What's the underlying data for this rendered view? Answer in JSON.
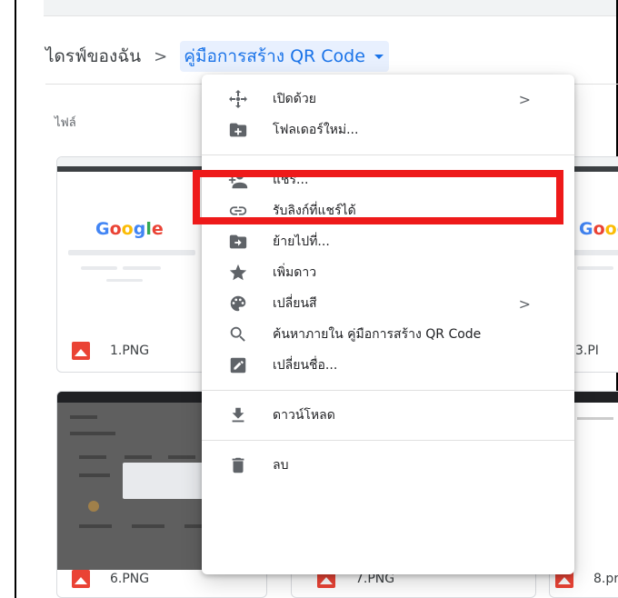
{
  "breadcrumb": {
    "root": "ไดรฟ์ของฉัน",
    "separator": ">",
    "current": "คู่มือการสร้าง QR Code"
  },
  "section": {
    "label": "ไฟล์"
  },
  "files": [
    {
      "name": "1.PNG",
      "thumb_text": "Google"
    },
    {
      "name": "3.PI",
      "thumb_text": "Goo"
    },
    {
      "name": "6.PNG"
    },
    {
      "name": "7.PNG"
    },
    {
      "name": "8.pr"
    }
  ],
  "menu": {
    "items": [
      {
        "icon": "open-with-icon",
        "label": "เปิดด้วย",
        "has_submenu": true
      },
      {
        "icon": "new-folder-icon",
        "label": "โฟลเดอร์ใหม่..."
      },
      {
        "icon": "share-icon",
        "label": "แชร์..."
      },
      {
        "icon": "link-icon",
        "label": "รับลิงก์ที่แชร์ได้"
      },
      {
        "icon": "move-icon",
        "label": "ย้ายไปที่..."
      },
      {
        "icon": "star-icon",
        "label": "เพิ่มดาว"
      },
      {
        "icon": "palette-icon",
        "label": "เปลี่ยนสี",
        "has_submenu": true
      },
      {
        "icon": "search-icon",
        "label": "ค้นหาภายใน คู่มือการสร้าง QR Code"
      },
      {
        "icon": "rename-icon",
        "label": "เปลี่ยนชื่อ..."
      },
      {
        "icon": "download-icon",
        "label": "ดาวน์โหลด"
      },
      {
        "icon": "trash-icon",
        "label": "ลบ"
      }
    ],
    "submenu_arrow": ">"
  },
  "colors": {
    "accent": "#1a73e8",
    "highlight": "#ee1a1a",
    "image_icon": "#ea4335"
  }
}
